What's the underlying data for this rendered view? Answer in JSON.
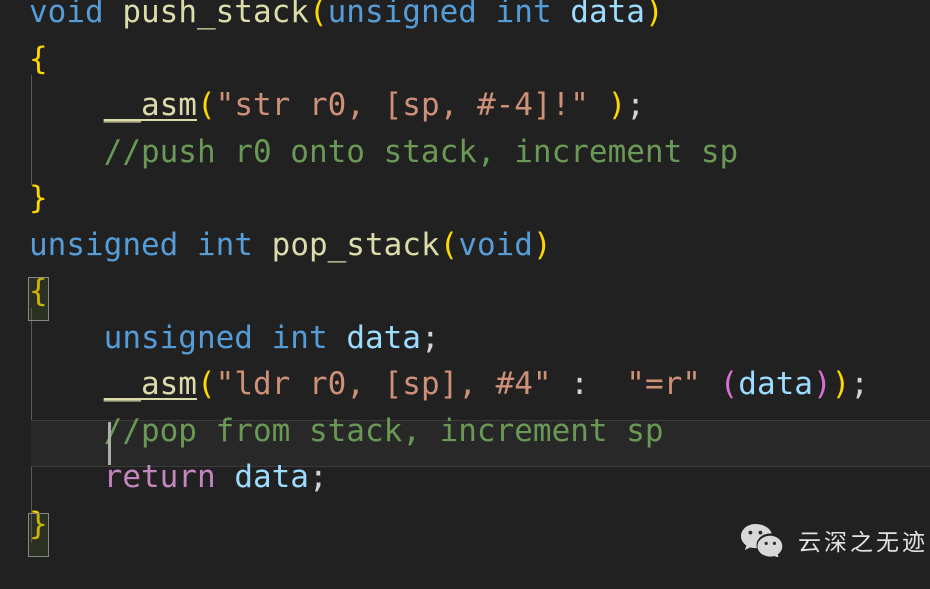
{
  "editor": {
    "theme": "dark-plus",
    "background": "#212121",
    "language": "c",
    "current_line_number": 10,
    "colors": {
      "keyword": "#569cd6",
      "function": "#dcdcaa",
      "variable": "#9cdcfe",
      "plain": "#d4d4d4",
      "string": "#ce9178",
      "comment": "#6a9955",
      "control": "#c586c0",
      "bracket_level_1": "#ffd700",
      "bracket_level_2": "#da70d6",
      "indent_guide": "#5a5a5a",
      "current_line_bg": "#282828",
      "current_line_border": "#3c3c3c",
      "cursor": "#aeafad",
      "bracket_match_border": "#888888"
    }
  },
  "code": {
    "lines": [
      {
        "id": "line-1",
        "text": "void push_stack(unsigned int data)",
        "tokens": [
          {
            "t": "void",
            "c": "t-kw"
          },
          {
            "t": " ",
            "c": "t-plain"
          },
          {
            "t": "push_stack",
            "c": "t-fn"
          },
          {
            "t": "(",
            "c": "t-br1"
          },
          {
            "t": "unsigned",
            "c": "t-kw"
          },
          {
            "t": " ",
            "c": "t-plain"
          },
          {
            "t": "int",
            "c": "t-kw"
          },
          {
            "t": " ",
            "c": "t-plain"
          },
          {
            "t": "data",
            "c": "t-var"
          },
          {
            "t": ")",
            "c": "t-br1"
          }
        ]
      },
      {
        "id": "line-2",
        "text": "{",
        "tokens": [
          {
            "t": "{",
            "c": "t-br1"
          }
        ]
      },
      {
        "id": "line-3",
        "text": "    __asm(\"str r0, [sp, #-4]!\" );",
        "tokens": [
          {
            "t": "    ",
            "c": "t-plain"
          },
          {
            "t": "__asm",
            "c": "t-fn-u"
          },
          {
            "t": "(",
            "c": "t-br1"
          },
          {
            "t": "\"str r0, [sp, #-4]!\"",
            "c": "t-str"
          },
          {
            "t": " ",
            "c": "t-plain"
          },
          {
            "t": ")",
            "c": "t-br1"
          },
          {
            "t": ";",
            "c": "t-plain"
          }
        ]
      },
      {
        "id": "line-4",
        "text": "    //push r0 onto stack, increment sp",
        "tokens": [
          {
            "t": "    ",
            "c": "t-plain"
          },
          {
            "t": "//push r0 onto stack, increment sp",
            "c": "t-cmt"
          }
        ]
      },
      {
        "id": "line-5",
        "text": "}",
        "tokens": [
          {
            "t": "}",
            "c": "t-br1"
          }
        ]
      },
      {
        "id": "line-6",
        "text": "unsigned int pop_stack(void)",
        "tokens": [
          {
            "t": "unsigned",
            "c": "t-kw"
          },
          {
            "t": " ",
            "c": "t-plain"
          },
          {
            "t": "int",
            "c": "t-kw"
          },
          {
            "t": " ",
            "c": "t-plain"
          },
          {
            "t": "pop_stack",
            "c": "t-fn"
          },
          {
            "t": "(",
            "c": "t-br1"
          },
          {
            "t": "void",
            "c": "t-kw"
          },
          {
            "t": ")",
            "c": "t-br1"
          }
        ]
      },
      {
        "id": "line-7",
        "text": "{",
        "tokens": [
          {
            "t": "{",
            "c": "t-br1"
          }
        ]
      },
      {
        "id": "line-8",
        "text": "    unsigned int data;",
        "tokens": [
          {
            "t": "    ",
            "c": "t-plain"
          },
          {
            "t": "unsigned",
            "c": "t-kw"
          },
          {
            "t": " ",
            "c": "t-plain"
          },
          {
            "t": "int",
            "c": "t-kw"
          },
          {
            "t": " ",
            "c": "t-plain"
          },
          {
            "t": "data",
            "c": "t-var"
          },
          {
            "t": ";",
            "c": "t-plain"
          }
        ]
      },
      {
        "id": "line-9",
        "text": "    __asm(\"ldr r0, [sp], #4\" :  \"=r\" (data));",
        "tokens": [
          {
            "t": "    ",
            "c": "t-plain"
          },
          {
            "t": "__asm",
            "c": "t-fn-u"
          },
          {
            "t": "(",
            "c": "t-br1"
          },
          {
            "t": "\"ldr r0, [sp], #4\"",
            "c": "t-str"
          },
          {
            "t": " ",
            "c": "t-plain"
          },
          {
            "t": ":",
            "c": "t-plain"
          },
          {
            "t": "  ",
            "c": "t-plain"
          },
          {
            "t": "\"=r\"",
            "c": "t-str"
          },
          {
            "t": " ",
            "c": "t-plain"
          },
          {
            "t": "(",
            "c": "t-br2"
          },
          {
            "t": "data",
            "c": "t-var"
          },
          {
            "t": ")",
            "c": "t-br2"
          },
          {
            "t": ")",
            "c": "t-br1"
          },
          {
            "t": ";",
            "c": "t-plain"
          }
        ]
      },
      {
        "id": "line-10",
        "text": "    //pop from stack, increment sp",
        "tokens": [
          {
            "t": "    ",
            "c": "t-plain"
          },
          {
            "t": "//pop from stack, increment sp",
            "c": "t-cmt"
          }
        ]
      },
      {
        "id": "line-11",
        "text": "    return data;",
        "tokens": [
          {
            "t": "    ",
            "c": "t-plain"
          },
          {
            "t": "return",
            "c": "t-ctrl"
          },
          {
            "t": " ",
            "c": "t-plain"
          },
          {
            "t": "data",
            "c": "t-var"
          },
          {
            "t": ";",
            "c": "t-plain"
          }
        ]
      },
      {
        "id": "line-12",
        "text": "}",
        "tokens": [
          {
            "t": "}",
            "c": "t-br1"
          }
        ]
      }
    ]
  },
  "watermark": {
    "text": "云深之无迹",
    "logo_name": "wechat-logo",
    "color": "#e2e2e2"
  }
}
